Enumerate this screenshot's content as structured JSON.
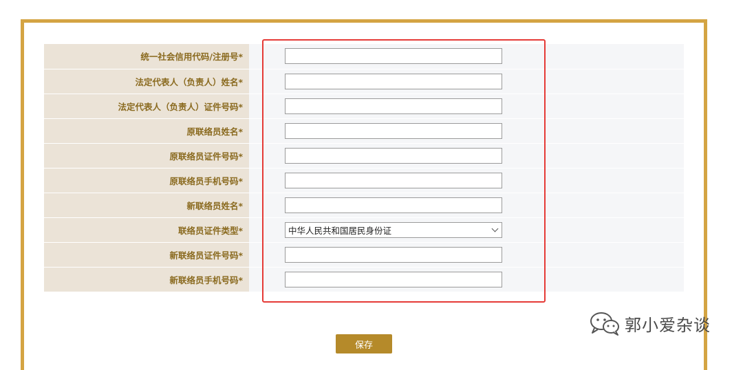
{
  "form": {
    "rows": [
      {
        "label": "统一社会信用代码/注册号*",
        "type": "text",
        "value": ""
      },
      {
        "label": "法定代表人（负责人）姓名*",
        "type": "text",
        "value": ""
      },
      {
        "label": "法定代表人（负责人）证件号码*",
        "type": "text",
        "value": ""
      },
      {
        "label": "原联络员姓名*",
        "type": "text",
        "value": ""
      },
      {
        "label": "原联络员证件号码*",
        "type": "text",
        "value": ""
      },
      {
        "label": "原联络员手机号码*",
        "type": "text",
        "value": ""
      },
      {
        "label": "新联络员姓名*",
        "type": "text",
        "value": ""
      },
      {
        "label": "联络员证件类型*",
        "type": "select",
        "value": "中华人民共和国居民身份证"
      },
      {
        "label": "新联络员证件号码*",
        "type": "text",
        "value": ""
      },
      {
        "label": "新联络员手机号码*",
        "type": "text",
        "value": ""
      }
    ],
    "save_label": "保存"
  },
  "watermark": {
    "text": "郭小爱杂谈",
    "icon": "wechat-icon"
  },
  "colors": {
    "frame_border": "#d4a443",
    "label_bg": "#ebe3d7",
    "label_text": "#8a6a1f",
    "input_row_bg": "#f5f6f8",
    "highlight": "#e53935",
    "save_button_bg": "#b58a2a"
  }
}
